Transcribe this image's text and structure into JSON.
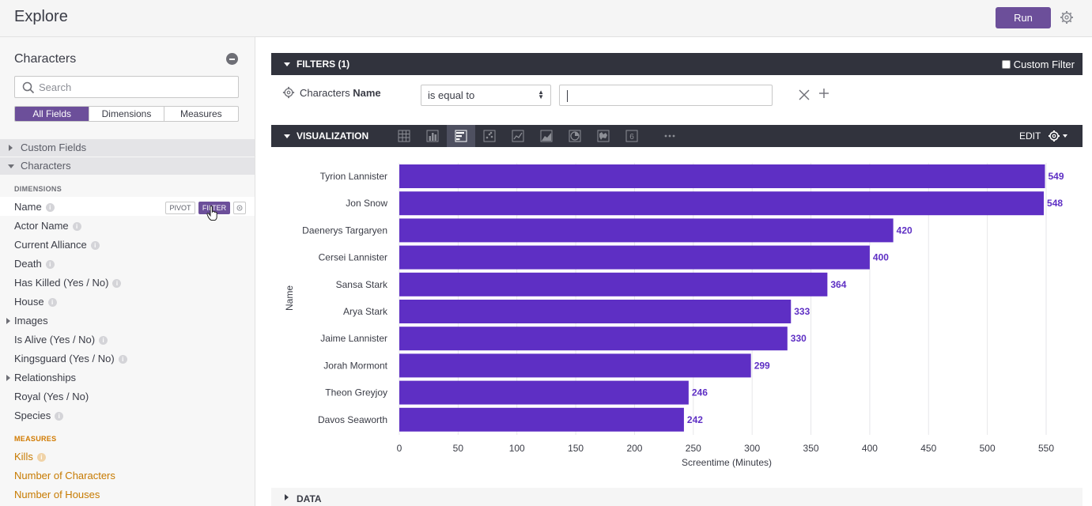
{
  "header": {
    "title": "Explore",
    "run_label": "Run"
  },
  "sidebar": {
    "view_name": "Characters",
    "search_placeholder": "Search",
    "tabs": [
      "All Fields",
      "Dimensions",
      "Measures"
    ],
    "groups": [
      "Custom Fields",
      "Characters"
    ],
    "dimensions_header": "DIMENSIONS",
    "dimensions": [
      "Name",
      "Actor Name",
      "Current Alliance",
      "Death",
      "Has Killed (Yes / No)",
      "House",
      "Images",
      "Is Alive (Yes / No)",
      "Kingsguard (Yes / No)",
      "Relationships",
      "Royal (Yes / No)",
      "Species"
    ],
    "measures_header": "MEASURES",
    "measures": [
      "Kills",
      "Number of Characters",
      "Number of Houses"
    ],
    "pivot_label": "PIVOT",
    "filter_label": "FILTER"
  },
  "filters": {
    "header": "FILTERS (1)",
    "custom_filter_label": "Custom Filter",
    "field_view": "Characters",
    "field_name": "Name",
    "operator": "is equal to",
    "value": ""
  },
  "visualization": {
    "header": "VISUALIZATION",
    "edit_label": "EDIT",
    "active_type": "bar",
    "more_icon": "more-icon",
    "number_icon_label": "6"
  },
  "data_section": {
    "label": "DATA"
  },
  "colors": {
    "bar": "#5e2fc4",
    "accent": "#6c4f9a",
    "header_bg": "#31333d"
  },
  "chart_data": {
    "type": "bar",
    "orientation": "horizontal",
    "categories": [
      "Tyrion Lannister",
      "Jon Snow",
      "Daenerys Targaryen",
      "Cersei Lannister",
      "Sansa Stark",
      "Arya Stark",
      "Jaime Lannister",
      "Jorah Mormont",
      "Theon Greyjoy",
      "Davos Seaworth"
    ],
    "values": [
      549,
      548,
      420,
      400,
      364,
      333,
      330,
      299,
      246,
      242
    ],
    "xlabel": "Screentime (Minutes)",
    "ylabel": "Name",
    "xlim": [
      0,
      550
    ],
    "xticks": [
      0,
      50,
      100,
      150,
      200,
      250,
      300,
      350,
      400,
      450,
      500,
      550
    ],
    "grid": true,
    "data_labels": true
  }
}
